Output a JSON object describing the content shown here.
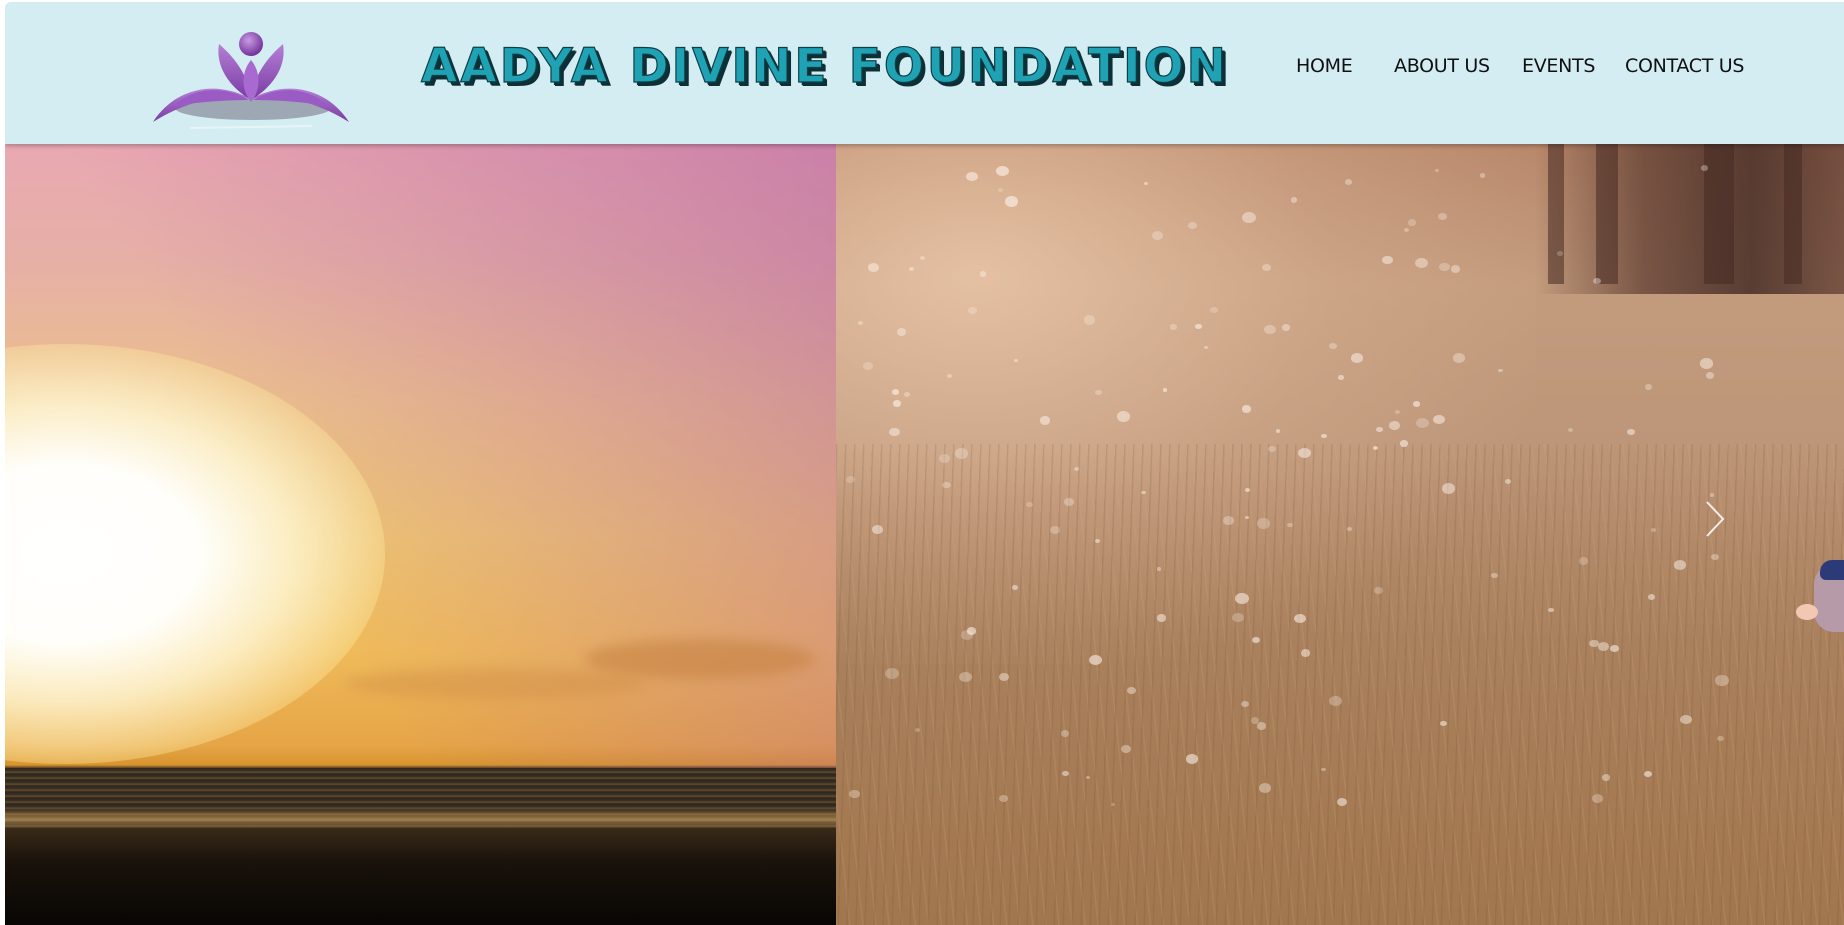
{
  "site": {
    "title": "AADYA DIVINE FOUNDATION",
    "logo_icon": "lotus-logo-icon"
  },
  "nav": {
    "items": [
      {
        "label": "HOME"
      },
      {
        "label": "ABOUT US"
      },
      {
        "label": "EVENTS"
      },
      {
        "label": "CONTACT US"
      }
    ]
  },
  "hero": {
    "left_image": "sunset-over-sea-image",
    "right_image": "child-in-dry-grass-field-image",
    "next_icon": "chevron-right-icon"
  },
  "colors": {
    "header_bg": "#d3edf2",
    "title_teal": "#1fa3b4",
    "title_shadow": "#0d2f36",
    "logo_purple": "#8e4fb5",
    "nav_text": "#111111"
  }
}
